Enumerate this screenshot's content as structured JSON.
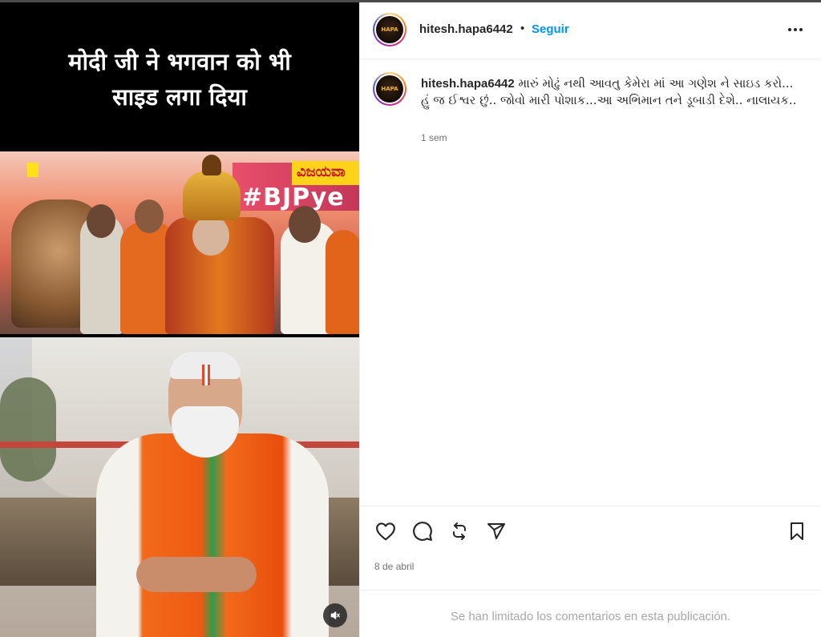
{
  "media": {
    "caption_lines": [
      "मोदी जी ने भगवान को भी",
      "साइड लगा दिया"
    ],
    "scene1": {
      "banner_text": "#BJPye",
      "channel_logo": "ವಿಜಯವಾ"
    },
    "mute_icon": "speaker-muted-icon"
  },
  "post": {
    "avatar_text": "HAPA",
    "username": "hitesh.hapa6442",
    "separator": "•",
    "follow_label": "Seguir",
    "more_icon": "more-options-icon",
    "caption_text": "મારું મોઢું નથી આવતુ કેમેરા માં આ ગણેશ ને સાઇડ કરો... હું જ ઈશ્વર છું.. જોવો મારી પોશાક...આ અભિમાન તને ડૂબાડી દેશે.. નાલાયક..",
    "time_ago": "1 sem",
    "date": "8 de abril",
    "comments_limited": "Se han limitado los comentarios en esta publicación."
  },
  "actions": {
    "like_icon": "heart-icon",
    "comment_icon": "comment-icon",
    "repost_icon": "repost-icon",
    "share_icon": "share-icon",
    "save_icon": "bookmark-icon"
  },
  "colors": {
    "accent": "#0095f6",
    "text_primary": "#262626",
    "text_secondary": "#737373",
    "text_muted": "#a8a8a8",
    "divider": "#efefef"
  }
}
